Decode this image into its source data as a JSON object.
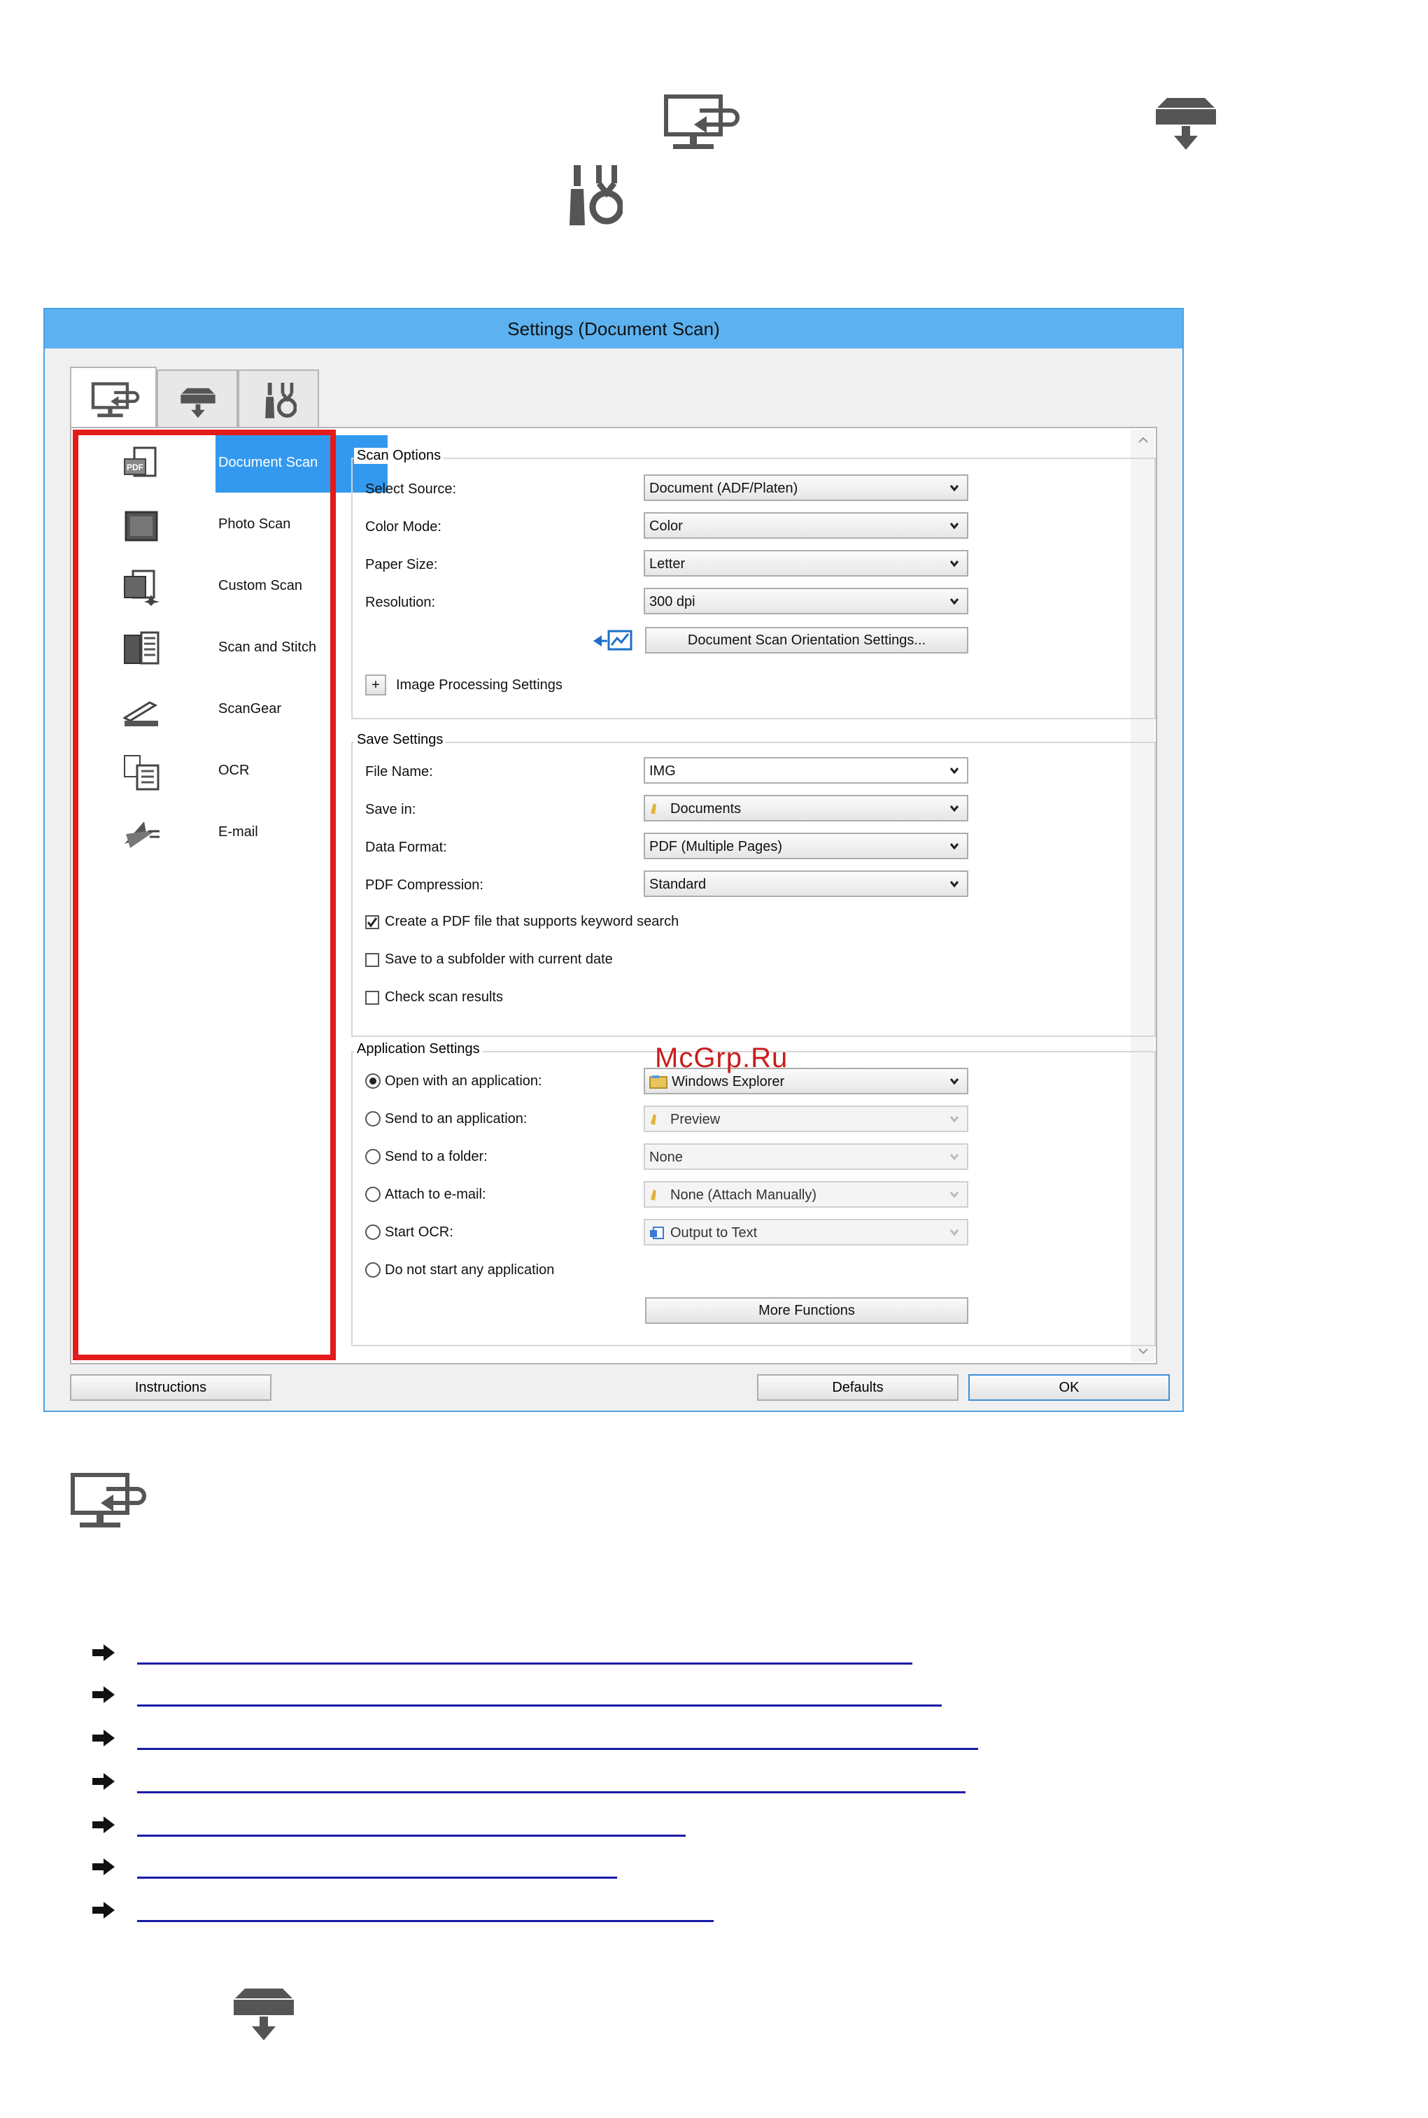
{
  "window": {
    "title": "Settings (Document Scan)"
  },
  "scan_modes": [
    {
      "label": "Document Scan",
      "icon": "document-scan-icon",
      "selected": true
    },
    {
      "label": "Photo Scan",
      "icon": "photo-scan-icon",
      "selected": false
    },
    {
      "label": "Custom Scan",
      "icon": "custom-scan-icon",
      "selected": false
    },
    {
      "label": "Scan and Stitch",
      "icon": "scan-and-stitch-icon",
      "selected": false
    },
    {
      "label": "ScanGear",
      "icon": "scangear-icon",
      "selected": false
    },
    {
      "label": "OCR",
      "icon": "ocr-icon",
      "selected": false
    },
    {
      "label": "E-mail",
      "icon": "email-icon",
      "selected": false
    }
  ],
  "scan_options": {
    "title": "Scan Options",
    "select_source": {
      "label": "Select Source:",
      "value": "Document (ADF/Platen)"
    },
    "color_mode": {
      "label": "Color Mode:",
      "value": "Color"
    },
    "paper_size": {
      "label": "Paper Size:",
      "value": "Letter"
    },
    "resolution": {
      "label": "Resolution:",
      "value": "300 dpi"
    },
    "orientation_button": "Document Scan Orientation Settings...",
    "image_processing": "Image Processing Settings",
    "expand_symbol": "+"
  },
  "save_settings": {
    "title": "Save Settings",
    "file_name": {
      "label": "File Name:",
      "value": "IMG"
    },
    "save_in": {
      "label": "Save in:",
      "value": "Documents"
    },
    "data_format": {
      "label": "Data Format:",
      "value": "PDF (Multiple Pages)"
    },
    "pdf_compression": {
      "label": "PDF Compression:",
      "value": "Standard"
    },
    "checkboxes": [
      {
        "label": "Create a PDF file that supports keyword search",
        "checked": true
      },
      {
        "label": "Save to a subfolder with current date",
        "checked": false
      },
      {
        "label": "Check scan results",
        "checked": false
      }
    ]
  },
  "application_settings": {
    "title": "Application Settings",
    "options": [
      {
        "label": "Open with an application:",
        "selected": true,
        "value": "Windows Explorer",
        "enabled": true
      },
      {
        "label": "Send to an application:",
        "selected": false,
        "value": "Preview",
        "enabled": false
      },
      {
        "label": "Send to a folder:",
        "selected": false,
        "value": "None",
        "enabled": false
      },
      {
        "label": "Attach to e-mail:",
        "selected": false,
        "value": "None (Attach Manually)",
        "enabled": false
      },
      {
        "label": "Start OCR:",
        "selected": false,
        "value": "Output to Text",
        "enabled": false
      },
      {
        "label": "Do not start any application",
        "selected": false,
        "value": null,
        "enabled": true
      }
    ],
    "more_functions": "More Functions"
  },
  "bottom_buttons": {
    "instructions": "Instructions",
    "defaults": "Defaults",
    "ok": "OK"
  },
  "watermark": "McGrp.Ru",
  "colors": {
    "title_bar": "#5cb2f0",
    "selection": "#3399ee",
    "highlight_box": "#e31b1b",
    "link": "#1a1aa6"
  }
}
